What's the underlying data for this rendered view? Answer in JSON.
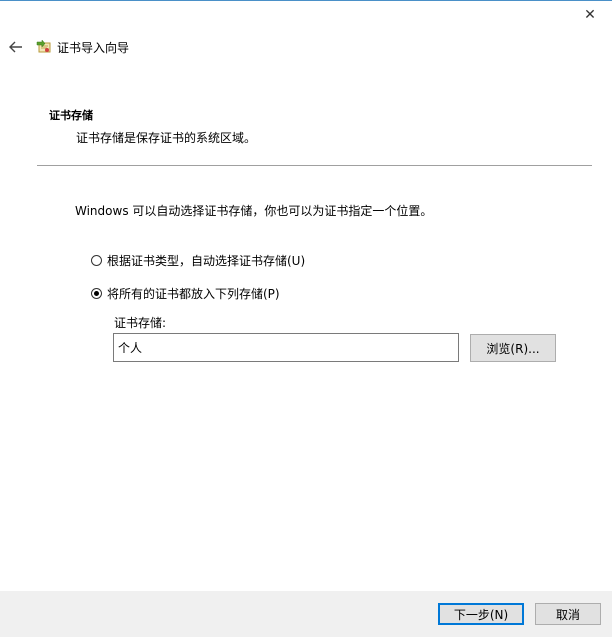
{
  "window": {
    "close_glyph": "✕"
  },
  "header": {
    "title": "证书导入向导"
  },
  "section": {
    "title": "证书存储",
    "description": "证书存储是保存证书的系统区域。"
  },
  "content": {
    "intro": "Windows 可以自动选择证书存储，你也可以为证书指定一个位置。",
    "options": [
      {
        "label": "根据证书类型，自动选择证书存储(U)",
        "selected": false
      },
      {
        "label": "将所有的证书都放入下列存储(P)",
        "selected": true
      }
    ],
    "store_label": "证书存储:",
    "store_value": "个人",
    "browse_label": "浏览(R)..."
  },
  "footer": {
    "next_label": "下一步(N)",
    "cancel_label": "取消"
  },
  "colors": {
    "accent": "#0078d7",
    "footer_bg": "#f0f0f0",
    "icon_green": "#5aa02c",
    "icon_cert": "#e8c050"
  }
}
